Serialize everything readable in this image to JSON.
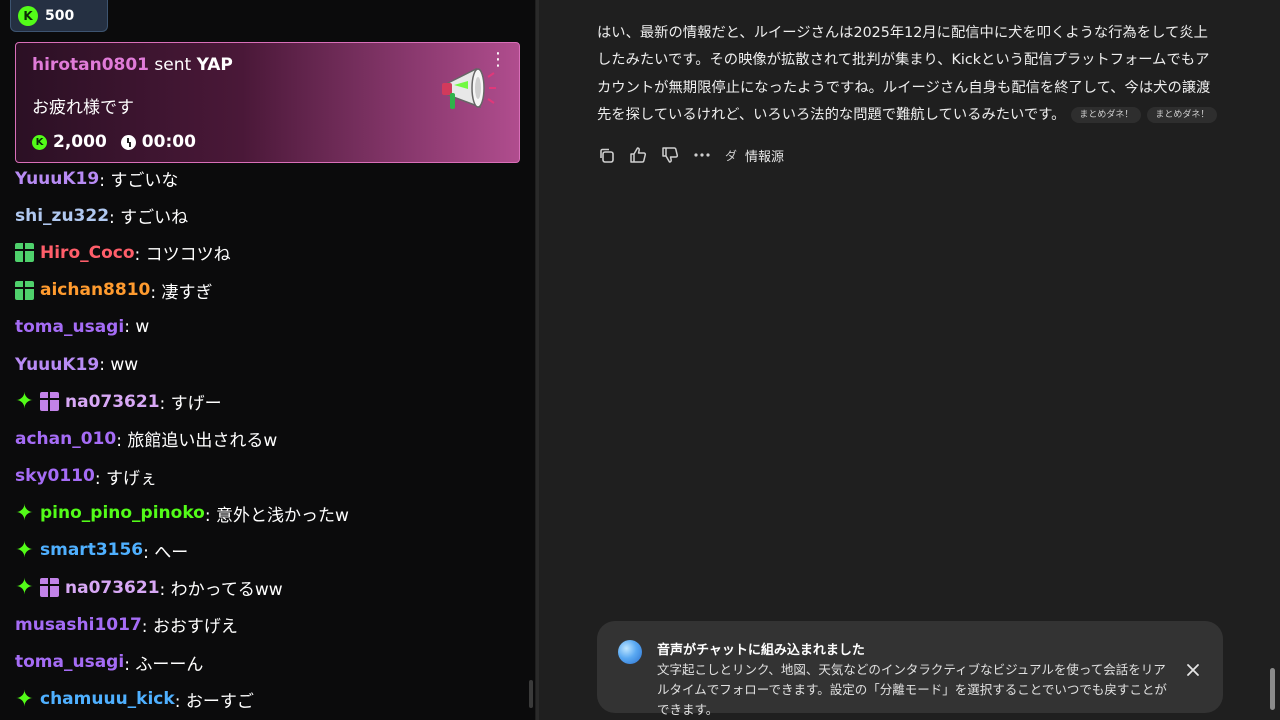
{
  "chat": {
    "points": "500",
    "yap": {
      "username": "hirotan0801",
      "sent": "sent",
      "item": "YAP",
      "message": "お疲れ様です",
      "amount": "2,000",
      "time": "00:00"
    },
    "messages": [
      {
        "user": "YuuuK19",
        "text": ": すごいな",
        "color": "#b88bf4",
        "badges": []
      },
      {
        "user": "shi_zu322",
        "text": ": すごいね",
        "color": "#b0c8f0",
        "badges": []
      },
      {
        "user": "Hiro_Coco",
        "text": ": コツコツね",
        "color": "#ff5e6a",
        "badges": [
          "gift"
        ]
      },
      {
        "user": "aichan8810",
        "text": ": 凄すぎ",
        "color": "#ff9b2f",
        "badges": [
          "gift"
        ]
      },
      {
        "user": "toma_usagi",
        "text": ": w",
        "color": "#a56cf5",
        "badges": []
      },
      {
        "user": "YuuuK19",
        "text": ": ww",
        "color": "#b88bf4",
        "badges": []
      },
      {
        "user": "na073621",
        "text": ": すげー",
        "color": "#d7a8f5",
        "badges": [
          "spark",
          "gift-purple"
        ]
      },
      {
        "user": "achan_010",
        "text": ": 旅館追い出されるw",
        "color": "#a56cf5",
        "badges": []
      },
      {
        "user": "sky0110",
        "text": ": すげぇ",
        "color": "#a56cf5",
        "badges": []
      },
      {
        "user": "pino_pino_pinoko",
        "text": ": 意外と浅かったw",
        "color": "#53fc18",
        "badges": [
          "spark"
        ]
      },
      {
        "user": "smart3156",
        "text": ": へー",
        "color": "#4fb0ff",
        "badges": [
          "spark"
        ]
      },
      {
        "user": "na073621",
        "text": ": わかってるww",
        "color": "#d7a8f5",
        "badges": [
          "spark",
          "gift-purple"
        ]
      },
      {
        "user": "musashi1017",
        "text": ": おおすげえ",
        "color": "#a56cf5",
        "badges": []
      },
      {
        "user": "toma_usagi",
        "text": ": ふーーん",
        "color": "#a56cf5",
        "badges": []
      },
      {
        "user": "chamuuu_kick",
        "text": ": おーすご",
        "color": "#4fb0ff",
        "badges": [
          "spark"
        ]
      }
    ]
  },
  "assistant": {
    "answer_text": "はい、最新の情報だと、ルイージさんは2025年12月に配信中に犬を叩くような行為をして炎上したみたいです。その映像が拡散されて批判が集まり、Kickという配信プラットフォームでもアカウントが無期限停止になったようですね。ルイージさん自身も配信を終了して、今は犬の譲渡先を探しているけれど、いろいろ法的な問題で難航しているみたいです。",
    "chips": [
      "まとめダネ！",
      "まとめダネ！"
    ],
    "sources_label": "情報源",
    "toast": {
      "title": "音声がチャットに組み込まれました",
      "body": "文字起こしとリンク、地図、天気などのインタラクティブなビジュアルを使って会話をリアルタイムでフォローできます。設定の「分離モード」を選択することでいつでも戻すことができます。"
    }
  },
  "icons": {
    "copy": "copy-icon",
    "thumb_up": "thumbs-up-icon",
    "thumb_down": "thumbs-down-icon",
    "more": "more-horizontal-icon",
    "close": "close-icon"
  },
  "colors": {
    "kick_green": "#53fc18",
    "yap_border": "#d96fb9",
    "assistant_bg": "#1f1f1f",
    "chat_bg": "#0b0b0c"
  }
}
